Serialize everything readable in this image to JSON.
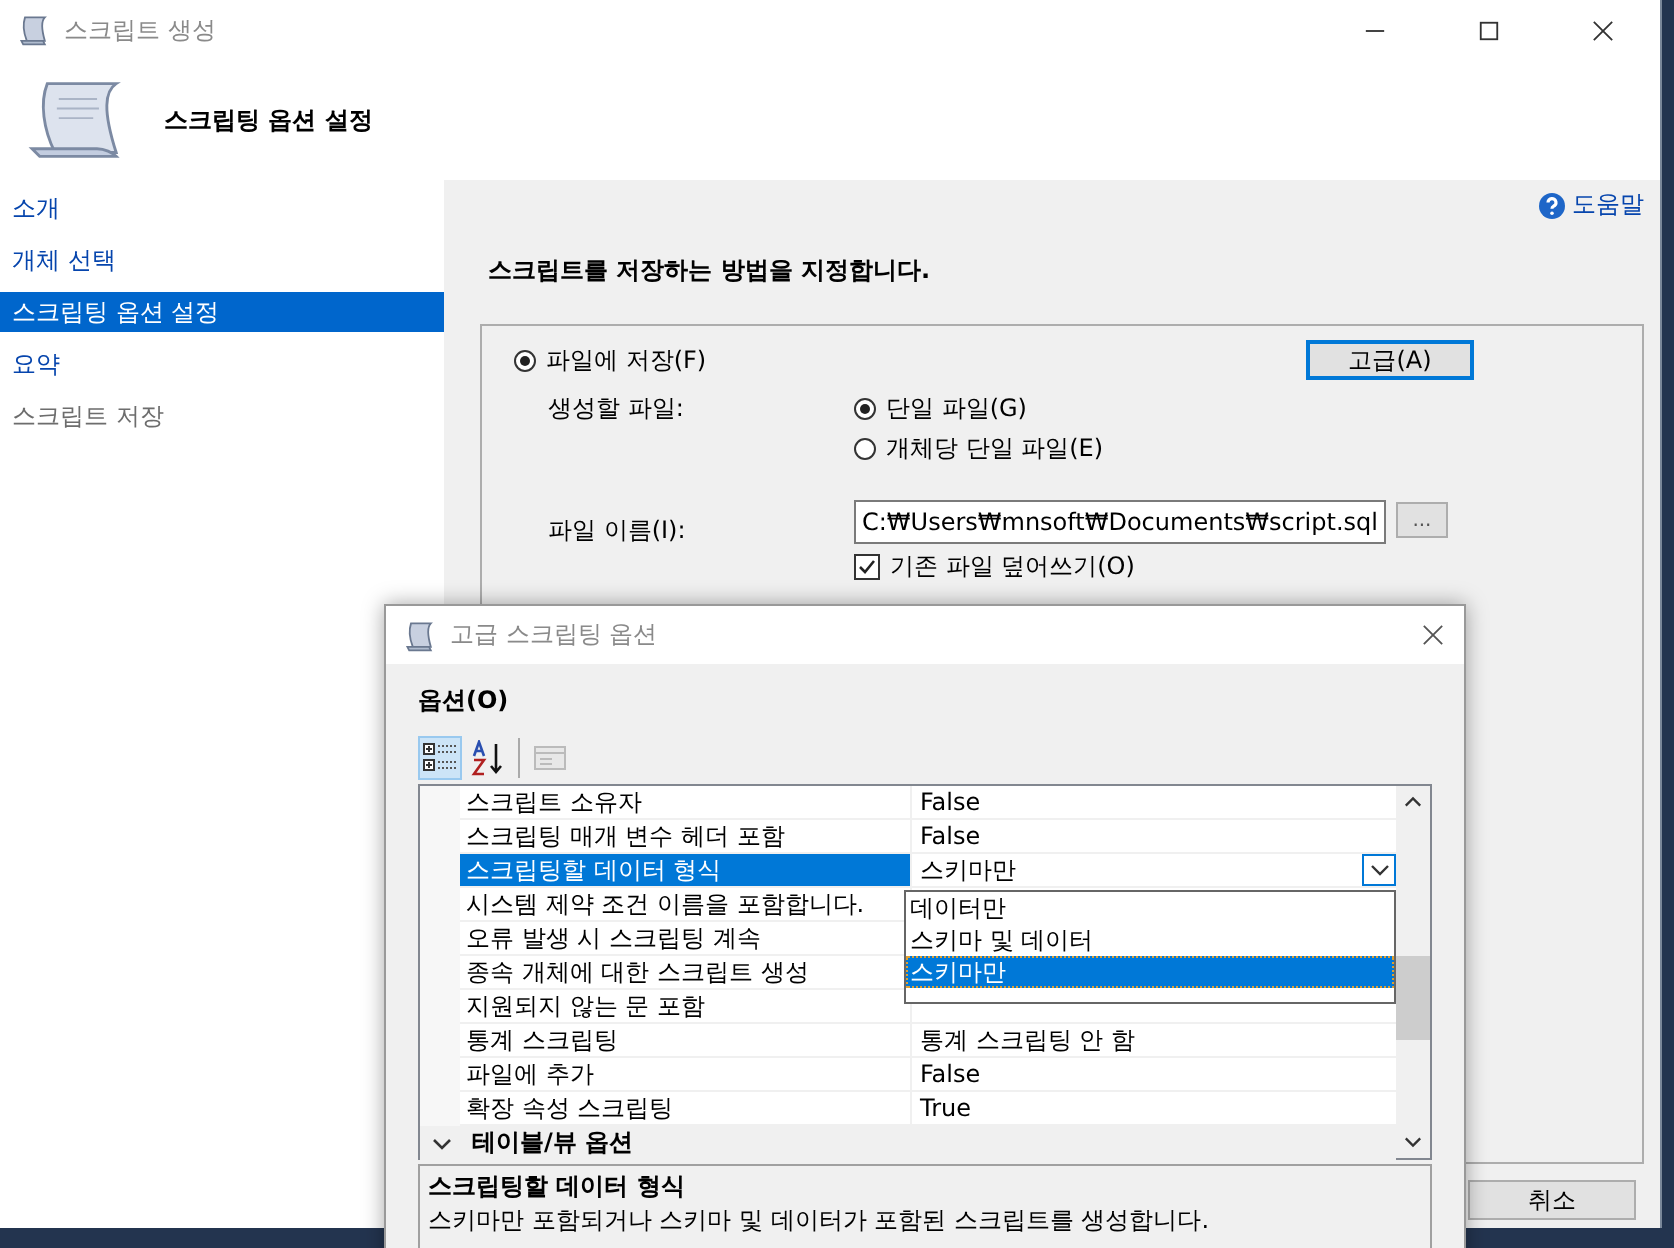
{
  "window": {
    "title": "스크립트 생성"
  },
  "header": {
    "title": "스크립팅 옵션 설정"
  },
  "sidebar": {
    "items": [
      {
        "label": "소개",
        "selected": false,
        "disabled": false
      },
      {
        "label": "개체 선택",
        "selected": false,
        "disabled": false
      },
      {
        "label": "스크립팅 옵션 설정",
        "selected": true,
        "disabled": false
      },
      {
        "label": "요약",
        "selected": false,
        "disabled": false
      },
      {
        "label": "스크립트 저장",
        "selected": false,
        "disabled": true
      }
    ]
  },
  "help_link": "도움말",
  "instruction": "스크립트를 저장하는 방법을 지정합니다.",
  "save_options": {
    "save_to_file": {
      "label": "파일에 저장(F)",
      "selected": true
    },
    "advanced_button": "고급(A)",
    "files_label": "생성할 파일:",
    "file_modes": [
      {
        "label": "단일 파일(G)",
        "selected": true
      },
      {
        "label": "개체당 단일 파일(E)",
        "selected": false
      }
    ],
    "filename_label": "파일 이름(I):",
    "filename": "C:₩Users₩mnsoft₩Documents₩script.sql",
    "browse_button": "...",
    "overwrite": {
      "label": "기존 파일 덮어쓰기(O)",
      "checked": true
    }
  },
  "cancel_button": "취소",
  "dialog": {
    "title": "고급 스크립팅 옵션",
    "section_label": "옵션(O)",
    "toolbar": [
      {
        "kind": "categorized",
        "selected": true,
        "disabled": false
      },
      {
        "kind": "alphabetical",
        "selected": false,
        "disabled": false
      },
      {
        "kind": "property_pages",
        "selected": false,
        "disabled": true
      }
    ],
    "grid": {
      "rows": [
        {
          "name": "스크립트 소유자",
          "value": "False",
          "selected": false
        },
        {
          "name": "스크립팅 매개 변수 헤더 포함",
          "value": "False",
          "selected": false
        },
        {
          "name": "스크립팅할 데이터 형식",
          "value": "스키마만",
          "selected": true
        },
        {
          "name": "시스템 제약 조건 이름을 포함합니다.",
          "selected": false
        },
        {
          "name": "오류 발생 시 스크립팅 계속",
          "selected": false
        },
        {
          "name": "종속 개체에 대한 스크립트 생성",
          "selected": false
        },
        {
          "name": "지원되지 않는 문 포함",
          "selected": false
        },
        {
          "name": "통계 스크립팅",
          "value": "통계 스크립팅 안 함",
          "selected": false
        },
        {
          "name": "파일에 추가",
          "value": "False",
          "selected": false
        },
        {
          "name": "확장 속성 스크립팅",
          "value": "True",
          "selected": false
        }
      ],
      "category": {
        "label": "테이블/뷰 옵션",
        "expanded": true
      }
    },
    "dropdown": {
      "options": [
        {
          "label": "데이터만",
          "selected": false
        },
        {
          "label": "스키마 및 데이터",
          "selected": false
        },
        {
          "label": "스키마만",
          "selected": true
        }
      ]
    },
    "description": {
      "title": "스크립팅할 데이터 형식",
      "text": "스키마만 포함되거나 스키마 및 데이터가 포함된 스크립트를 생성합니다."
    }
  }
}
